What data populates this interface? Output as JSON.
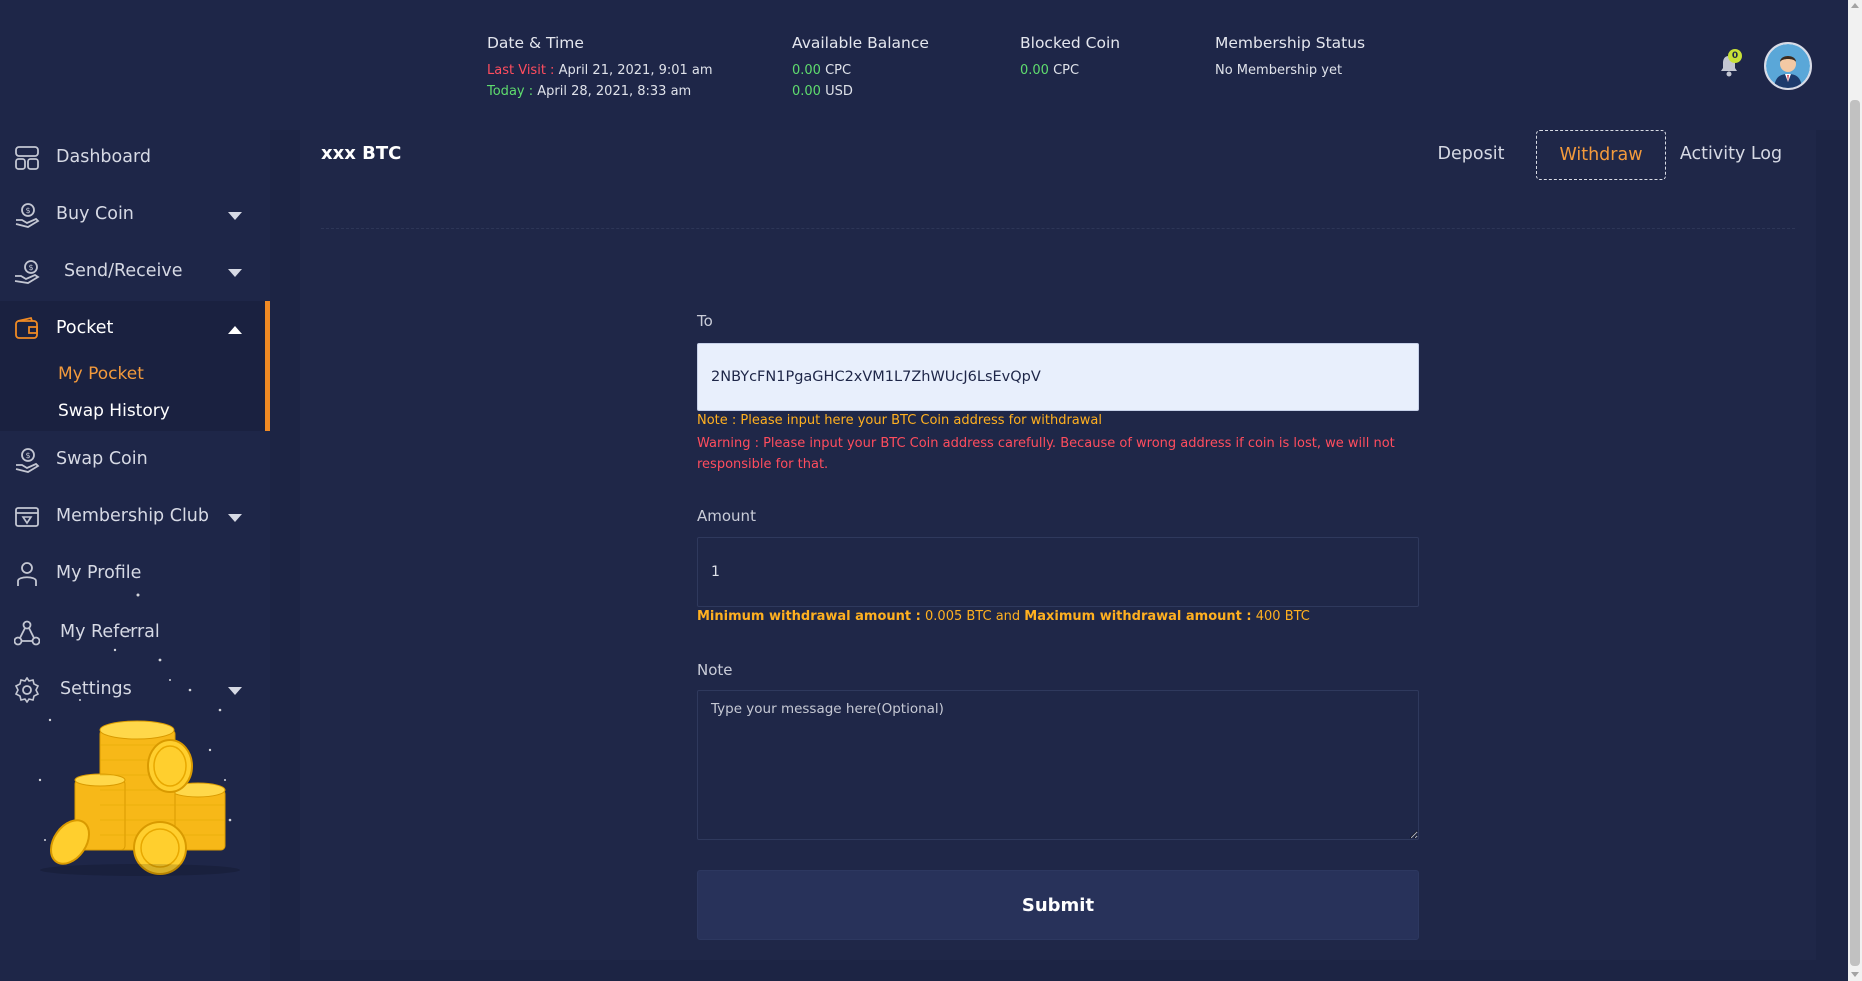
{
  "header": {
    "date_time": {
      "heading": "Date & Time",
      "last_visit_label": "Last Visit :",
      "last_visit_value": "April 21, 2021, 9:01 am",
      "today_label": "Today :",
      "today_value": "April 28, 2021, 8:33 am"
    },
    "available_balance": {
      "heading": "Available Balance",
      "cpc_value": "0.00",
      "cpc_unit": "CPC",
      "usd_value": "0.00",
      "usd_unit": "USD"
    },
    "blocked_coin": {
      "heading": "Blocked Coin",
      "value": "0.00",
      "unit": "CPC"
    },
    "membership": {
      "heading": "Membership Status",
      "value": "No Membership yet"
    },
    "notifications_count": "0"
  },
  "sidebar": {
    "items": [
      {
        "label": "Dashboard",
        "icon": "dashboard-icon"
      },
      {
        "label": "Buy Coin",
        "icon": "coin-hand-icon"
      },
      {
        "label": "Send/Receive",
        "icon": "send-receive-icon"
      },
      {
        "label": "Pocket",
        "icon": "wallet-icon"
      },
      {
        "label": "Swap Coin",
        "icon": "swap-coin-icon"
      },
      {
        "label": "Membership Club",
        "icon": "membership-icon"
      },
      {
        "label": "My Profile",
        "icon": "user-icon"
      },
      {
        "label": "My Referral",
        "icon": "referral-icon"
      },
      {
        "label": "Settings",
        "icon": "gear-icon"
      }
    ],
    "pocket_sub": [
      "My Pocket",
      "Swap History"
    ]
  },
  "main": {
    "title": "xxx BTC",
    "tabs": [
      "Deposit",
      "Withdraw",
      "Activity Log"
    ],
    "active_tab": "Withdraw",
    "form": {
      "to_label": "To",
      "to_value": "2NBYcFN1PgaGHC2xVM1L7ZhWUcJ6LsEvQpV",
      "note": "Note : Please input here your BTC Coin address for withdrawal",
      "warning": "Warning : Please input your BTC Coin address carefully. Because of wrong address if coin is lost, we will not responsible for that.",
      "amount_label": "Amount",
      "amount_value": "1",
      "min_label": "Minimum withdrawal amount :",
      "min_value": "0.005 BTC",
      "and_text": "and",
      "max_label": "Maximum withdrawal amount :",
      "max_value": "400 BTC",
      "note_label": "Note",
      "note_placeholder": "Type your message here(Optional)",
      "submit_label": "Submit"
    }
  },
  "colors": {
    "background": "#1c2444",
    "accent": "#f08a24",
    "warning": "#ff4d5e",
    "positive": "#5fdc6e",
    "highlight": "#ffb020"
  }
}
